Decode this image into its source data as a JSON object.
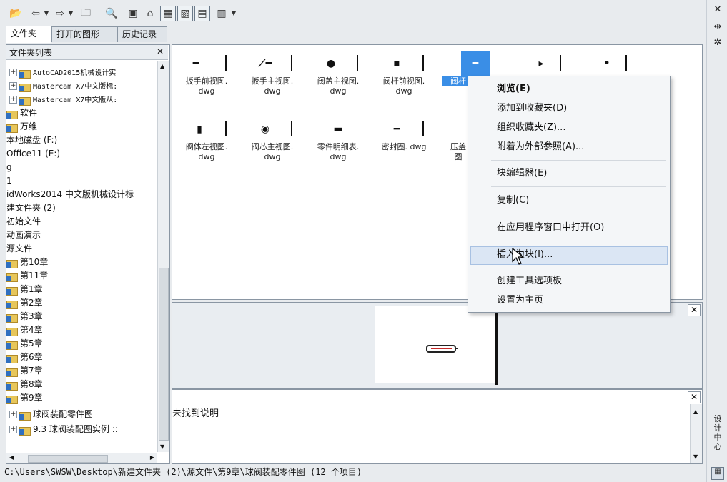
{
  "toolbar": {
    "icons": [
      "open-folder-icon",
      "back-icon",
      "dropdown-icon",
      "forward-icon",
      "dropdown-icon",
      "up-folder-icon",
      "search-icon",
      "favorites-icon",
      "home-icon",
      "tree-toggle-icon",
      "preview-toggle-icon",
      "description-toggle-icon",
      "views-icon",
      "dropdown-icon"
    ]
  },
  "right_strip": {
    "close_glyph": "✕",
    "auto_hide_glyph": "⇹",
    "properties_glyph": "✲",
    "vertical_title": "设计中心"
  },
  "tabs": [
    "文件夹",
    "打开的图形",
    "历史记录"
  ],
  "tree": {
    "header": "文件夹列表",
    "close_glyph": "✕",
    "nodes": [
      {
        "label": "AutoCAD2015机械设计实"
      },
      {
        "label": "Mastercam X7中文版标:"
      },
      {
        "label": "Mastercam X7中文版从:"
      },
      {
        "label": "软件"
      },
      {
        "label": "万维"
      },
      {
        "label": "本地磁盘 (F:)"
      },
      {
        "label": "Office11 (E:)"
      },
      {
        "label": "g"
      },
      {
        "label": "1"
      },
      {
        "label": "idWorks2014 中文版机械设计标"
      },
      {
        "label": "建文件夹 (2)"
      },
      {
        "label": "初始文件"
      },
      {
        "label": "动画演示"
      },
      {
        "label": "源文件"
      },
      {
        "label": "第10章"
      },
      {
        "label": "第11章"
      },
      {
        "label": "第1章"
      },
      {
        "label": "第2章"
      },
      {
        "label": "第3章"
      },
      {
        "label": "第4章"
      },
      {
        "label": "第5章"
      },
      {
        "label": "第6章"
      },
      {
        "label": "第7章"
      },
      {
        "label": "第8章"
      },
      {
        "label": "第9章"
      },
      {
        "label": "球阀装配零件图"
      },
      {
        "label": "9.3  球阀装配图实例 ::"
      }
    ]
  },
  "files": [
    {
      "name": "扳手前视图.",
      "ext": "dwg"
    },
    {
      "name": "扳手主视图.",
      "ext": "dwg"
    },
    {
      "name": "阀盖主视图.",
      "ext": "dwg"
    },
    {
      "name": "阀杆前视图.",
      "ext": "dwg"
    },
    {
      "name": "阀杆",
      "ext": ""
    },
    {
      "name": "",
      "ext": ""
    },
    {
      "name": "",
      "ext": ""
    },
    {
      "name": "阀体左视图.",
      "ext": "dwg"
    },
    {
      "name": "阀芯主视图.",
      "ext": "dwg"
    },
    {
      "name": "零件明细表.",
      "ext": "dwg"
    },
    {
      "name": "密封圈. dwg",
      "ext": ""
    },
    {
      "name": "压盖",
      "ext": "图"
    }
  ],
  "context_menu": {
    "items": [
      {
        "label": "浏览(E)",
        "bold": true
      },
      {
        "label": "添加到收藏夹(D)"
      },
      {
        "label": "组织收藏夹(Z)..."
      },
      {
        "label": "附着为外部参照(A)..."
      },
      {
        "label": "块编辑器(E)"
      },
      {
        "label": "复制(C)"
      },
      {
        "label": "在应用程序窗口中打开(O)"
      },
      {
        "label": "插入为块(I)..."
      },
      {
        "label": "创建工具选项板"
      },
      {
        "label": "设置为主页"
      }
    ]
  },
  "preview": {
    "close_glyph": "✕"
  },
  "description": {
    "text": "未找到说明",
    "close_glyph": "✕"
  },
  "status": {
    "path": "C:\\Users\\SWSW\\Desktop\\新建文件夹 (2)\\源文件\\第9章\\球阀装配零件图 (12 个项目)"
  }
}
